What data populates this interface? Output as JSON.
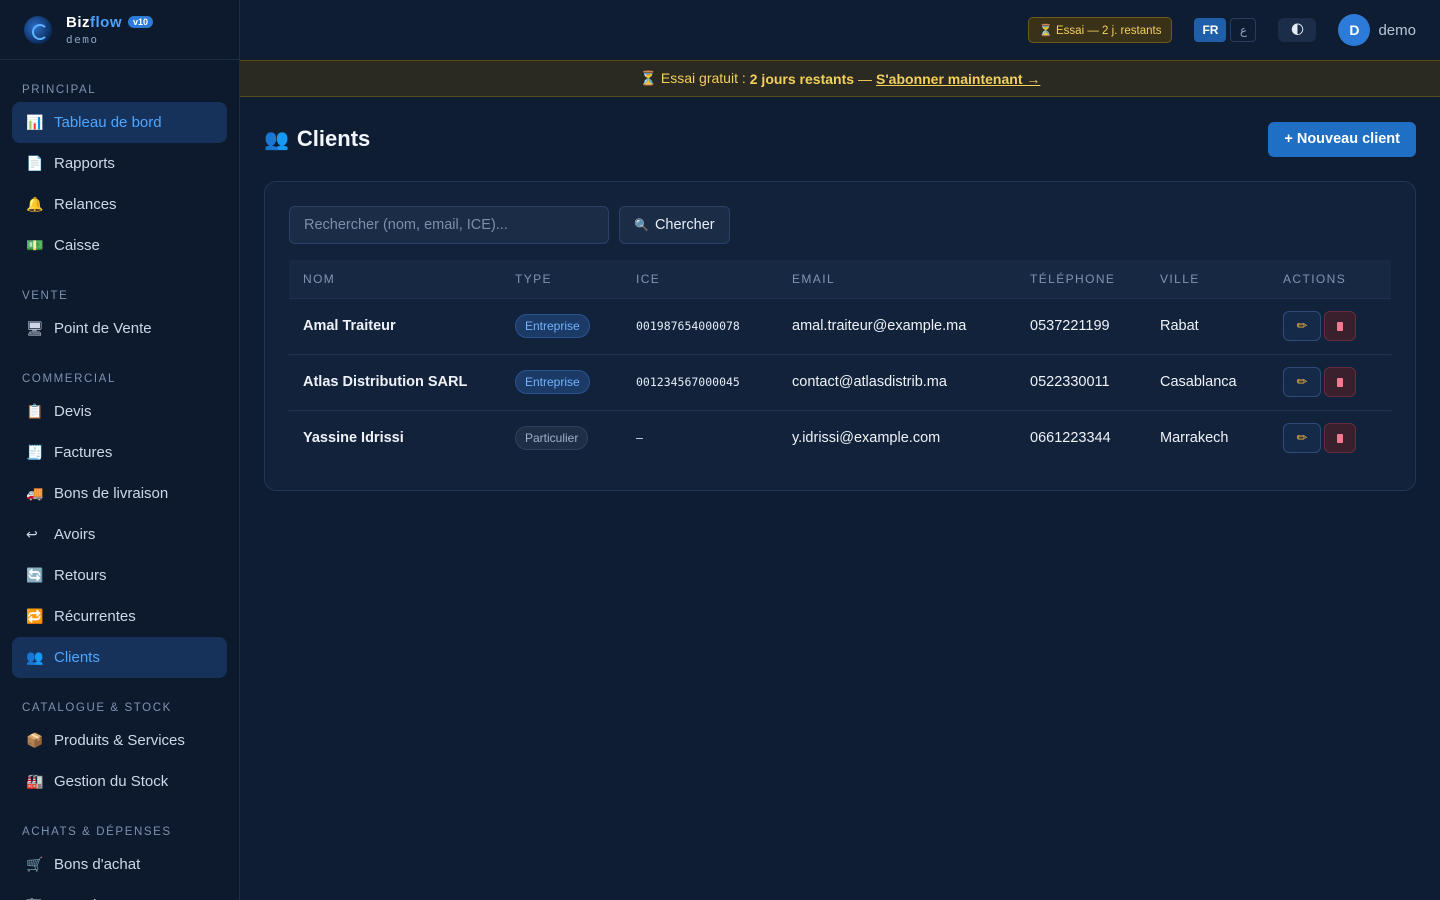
{
  "brand": {
    "name_a": "Biz",
    "name_b": "flow",
    "version": "v10",
    "subtitle": "demo",
    "logo_caption": "Biz Flow"
  },
  "sidebar": {
    "sections": [
      {
        "title": "PRINCIPAL",
        "items": [
          {
            "label": "Tableau de bord",
            "icon": "chart-icon",
            "glyph": "📊",
            "active": true
          },
          {
            "label": "Rapports",
            "icon": "report-icon",
            "glyph": "📄"
          },
          {
            "label": "Relances",
            "icon": "bell-icon",
            "glyph": "🔔"
          },
          {
            "label": "Caisse",
            "icon": "cash-icon",
            "glyph": "💵"
          }
        ]
      },
      {
        "title": "VENTE",
        "items": [
          {
            "label": "Point de Vente",
            "icon": "monitor-icon",
            "glyph": "🖥"
          }
        ]
      },
      {
        "title": "COMMERCIAL",
        "items": [
          {
            "label": "Devis",
            "icon": "clipboard-icon",
            "glyph": "📋"
          },
          {
            "label": "Factures",
            "icon": "receipt-icon",
            "glyph": "🧾"
          },
          {
            "label": "Bons de livraison",
            "icon": "truck-icon",
            "glyph": "🚚"
          },
          {
            "label": "Avoirs",
            "icon": "return-arrow-icon",
            "glyph": "↩"
          },
          {
            "label": "Retours",
            "icon": "refresh-icon",
            "glyph": "🔄"
          },
          {
            "label": "Récurrentes",
            "icon": "repeat-icon",
            "glyph": "🔁"
          },
          {
            "label": "Clients",
            "icon": "users-icon",
            "glyph": "👥",
            "active": true
          }
        ]
      },
      {
        "title": "CATALOGUE & STOCK",
        "items": [
          {
            "label": "Produits & Services",
            "icon": "box-icon",
            "glyph": "📦"
          },
          {
            "label": "Gestion du Stock",
            "icon": "warehouse-icon",
            "glyph": "🏭"
          }
        ]
      },
      {
        "title": "ACHATS & DÉPENSES",
        "items": [
          {
            "label": "Bons d'achat",
            "icon": "cart-icon",
            "glyph": "🛒"
          },
          {
            "label": "Fournisseurs",
            "icon": "supplier-icon",
            "glyph": "🏗"
          }
        ]
      }
    ]
  },
  "topbar": {
    "trial_chip": "⏳ Essai — 2 j. restants",
    "lang_fr": "FR",
    "lang_ar": "ع",
    "theme_icon": "🌓",
    "avatar_initial": "D",
    "user_name": "demo"
  },
  "banner": {
    "prefix": "⏳ Essai gratuit :",
    "bold": "2 jours restants",
    "dash": "—",
    "link": "S'abonner maintenant →"
  },
  "page": {
    "title_icon": "👥",
    "title": "Clients",
    "new_button": "+ Nouveau client"
  },
  "search": {
    "placeholder": "Rechercher (nom, email, ICE)...",
    "button_icon": "🔍",
    "button_label": "Chercher"
  },
  "table": {
    "columns": [
      "NOM",
      "TYPE",
      "ICE",
      "EMAIL",
      "TÉLÉPHONE",
      "VILLE",
      "ACTIONS"
    ],
    "rows": [
      {
        "nom": "Amal Traiteur",
        "type": "Entreprise",
        "ice": "001987654000078",
        "email": "amal.traiteur@example.ma",
        "tel": "0537221199",
        "ville": "Rabat"
      },
      {
        "nom": "Atlas Distribution SARL",
        "type": "Entreprise",
        "ice": "001234567000045",
        "email": "contact@atlasdistrib.ma",
        "tel": "0522330011",
        "ville": "Casablanca"
      },
      {
        "nom": "Yassine Idrissi",
        "type": "Particulier",
        "ice": "–",
        "email": "y.idrissi@example.com",
        "tel": "0661223344",
        "ville": "Marrakech"
      }
    ],
    "edit_icon": "✏"
  },
  "colors": {
    "accent": "#1f6fc4",
    "active_text": "#4fa6ff",
    "warning": "#f4cf5b"
  }
}
